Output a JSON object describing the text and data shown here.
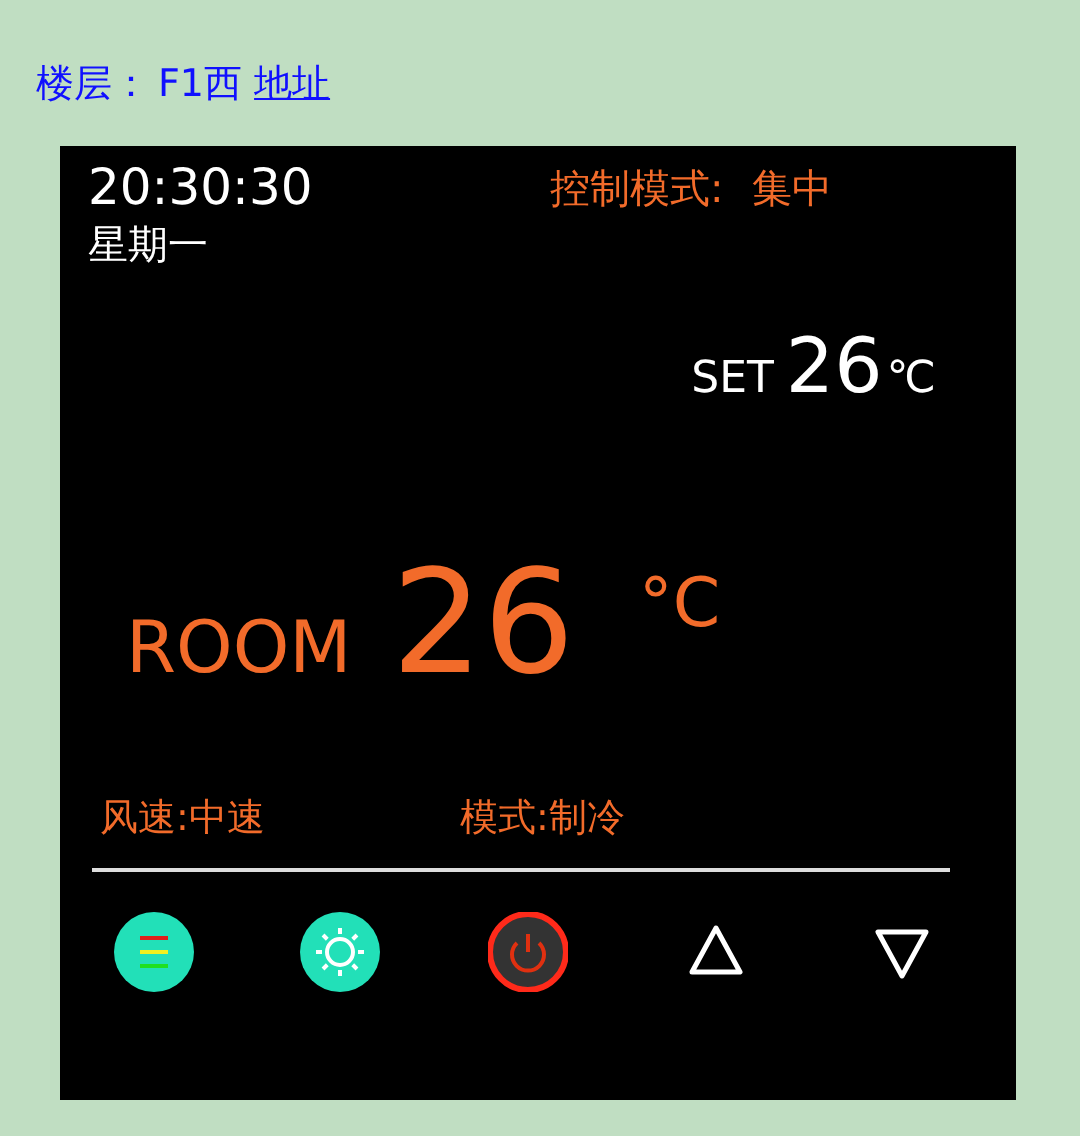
{
  "floor": {
    "label": "楼层：",
    "value": "F1西",
    "link": "地址"
  },
  "panel": {
    "time": "20:30:30",
    "weekday": "星期一",
    "control_mode": {
      "label": "控制模式:",
      "value": "集中"
    },
    "set": {
      "label": "SET",
      "value": "26",
      "unit": "℃"
    },
    "room": {
      "label": "ROOM",
      "value": "26",
      "unit": "°C"
    },
    "fan_speed": "风速:中速",
    "mode": "模式:制冷",
    "buttons": [
      {
        "kind": "fan"
      },
      {
        "kind": "mode"
      },
      {
        "kind": "power"
      },
      {
        "kind": "up"
      },
      {
        "kind": "down"
      }
    ]
  }
}
